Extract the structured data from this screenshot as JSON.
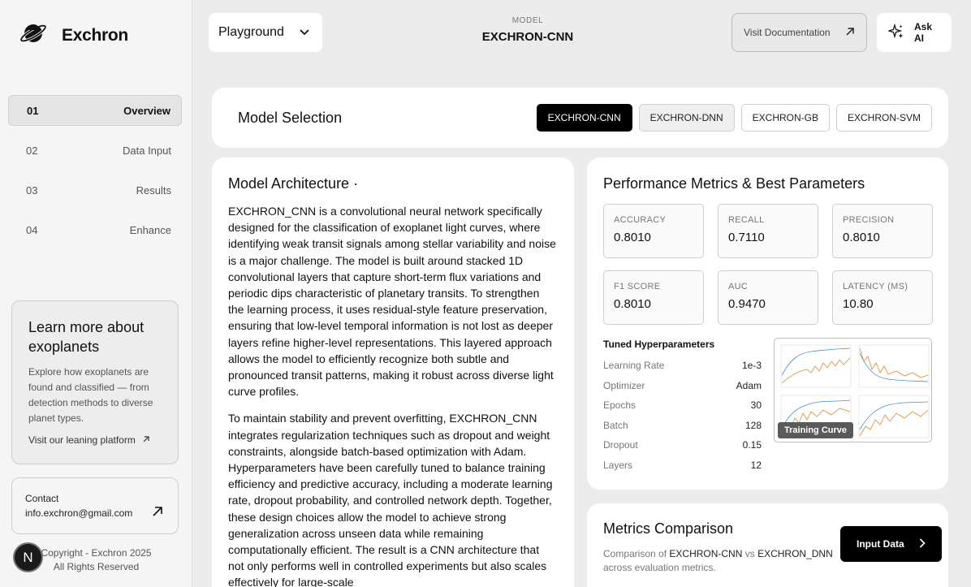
{
  "brand": {
    "name": "Exchron"
  },
  "nav": [
    {
      "num": "01",
      "label": "Overview"
    },
    {
      "num": "02",
      "label": "Data Input"
    },
    {
      "num": "03",
      "label": "Results"
    },
    {
      "num": "04",
      "label": "Enhance"
    }
  ],
  "learn": {
    "title": "Learn more about exoplanets",
    "desc": "Explore how exoplanets are found and classified — from detection methods to diverse planet types.",
    "link": "Visit our leaning platform"
  },
  "contact": {
    "label": "Contact",
    "email": "info.exchron@gmail.com"
  },
  "copyright": {
    "line1": "Copyright - Exchron 2025",
    "line2": "All Rights Reserved"
  },
  "avatar": {
    "initial": "N"
  },
  "header": {
    "dropdown": "Playground",
    "model_key": "MODEL",
    "model_value": "EXCHRON-CNN",
    "doc_label": "Visit Documentation",
    "ai_label": "Ask AI"
  },
  "selection": {
    "title": "Model Selection",
    "tabs": [
      "EXCHRON-CNN",
      "EXCHRON-DNN",
      "EXCHRON-GB",
      "EXCHRON-SVM"
    ]
  },
  "architecture": {
    "title": "Model Architecture ·",
    "p1": "EXCHRON_CNN is a convolutional neural network specifically designed for the classification of exoplanet light curves, where identifying weak transit signals among stellar variability and noise is a major challenge. The model is built around stacked 1D convolutional layers that capture short-term flux variations and periodic dips characteristic of planetary transits. To strengthen the learning process, it uses residual-style feature preservation, ensuring that low-level temporal information is not lost as deeper layers refine higher-level representations. This layered approach allows the model to efficiently recognize both subtle and pronounced transit patterns, making it robust across diverse light curve profiles.",
    "p2": "To maintain stability and prevent overfitting, EXCHRON_CNN integrates regularization techniques such as dropout and weight constraints, alongside batch-based optimization with Adam. Hyperparameters have been carefully tuned to balance training efficiency and predictive accuracy, including a moderate learning rate, dropout probability, and controlled network depth. Together, these design choices allow the model to achieve strong generalization across unseen data while remaining computationally efficient. The result is a CNN architecture that not only performs well in controlled experiments but also scales effectively for large-scale"
  },
  "metrics": {
    "title": "Performance Metrics & Best Parameters",
    "cards": [
      {
        "label": "ACCURACY",
        "value": "0.8010"
      },
      {
        "label": "RECALL",
        "value": "0.7110"
      },
      {
        "label": "PRECISION",
        "value": "0.8010"
      },
      {
        "label": "F1 SCORE",
        "value": "0.8010"
      },
      {
        "label": "AUC",
        "value": "0.9470"
      },
      {
        "label": "LATENCY (MS)",
        "value": "10.80"
      }
    ],
    "hp_title": "Tuned Hyperparameters",
    "hyperparameters": [
      {
        "label": "Learning Rate",
        "value": "1e-3"
      },
      {
        "label": "Optimizer",
        "value": "Adam"
      },
      {
        "label": "Epochs",
        "value": "30"
      },
      {
        "label": "Batch",
        "value": "128"
      },
      {
        "label": "Dropout",
        "value": "0.15"
      },
      {
        "label": "Layers",
        "value": "12"
      }
    ],
    "curve_button": "Training Curve"
  },
  "comparison": {
    "title": "Metrics Comparison",
    "desc_pre": "Comparison of",
    "model_a": "EXCHRON-CNN",
    "vs": "vs",
    "model_b": "EXCHRON_DNN",
    "desc_post": "across evaluation metrics."
  },
  "input_button": "Input Data",
  "colors": {
    "accent": "#000000",
    "background": "#ececec",
    "card": "#ffffff"
  }
}
